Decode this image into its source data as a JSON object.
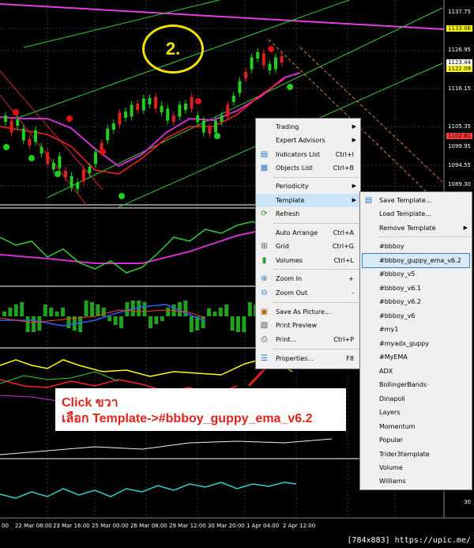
{
  "price_axis": {
    "labels": [
      "1137.75",
      "1126.95",
      "1116.15",
      "1105.35",
      "1099.95",
      "1094.55",
      "1089.30"
    ],
    "tags": [
      {
        "text": "1133.06",
        "color": "#ffff00"
      },
      {
        "text": "1123.44",
        "color": "#ffffff"
      },
      {
        "text": "1122.09",
        "color": "#ffff00"
      },
      {
        "text": "1102.81",
        "color": "#ff3b3b"
      }
    ],
    "indicator_label": "30"
  },
  "time_axis": [
    "00",
    "22 Mar 08:00",
    "23 Mar 16:00",
    "25 Mar 00:00",
    "26 Mar 08:00",
    "29 Mar 12:00",
    "30 Mar 20:00",
    "1 Apr 04:00",
    "2 Apr 12:00"
  ],
  "step_number": "2.",
  "context_menu": {
    "items": [
      {
        "label": "Trading",
        "shortcut": "",
        "icon": "",
        "submenu": true
      },
      {
        "label": "Expert Advisors",
        "shortcut": "",
        "icon": "",
        "submenu": true
      },
      {
        "label": "Indicators List",
        "shortcut": "Ctrl+I",
        "icon": "indicators-list-icon",
        "submenu": false
      },
      {
        "label": "Objects List",
        "shortcut": "Ctrl+B",
        "icon": "objects-list-icon",
        "submenu": false
      },
      {
        "label": "Periodicity",
        "shortcut": "",
        "icon": "",
        "submenu": true
      },
      {
        "label": "Template",
        "shortcut": "",
        "icon": "",
        "submenu": true
      },
      {
        "label": "Refresh",
        "shortcut": "",
        "icon": "refresh-icon",
        "submenu": false
      },
      {
        "label": "Auto Arrange",
        "shortcut": "Ctrl+A",
        "icon": "",
        "submenu": false
      },
      {
        "label": "Grid",
        "shortcut": "Ctrl+G",
        "icon": "grid-icon",
        "submenu": false
      },
      {
        "label": "Volumes",
        "shortcut": "Ctrl+L",
        "icon": "volumes-icon",
        "submenu": false
      },
      {
        "label": "Zoom In",
        "shortcut": "+",
        "icon": "zoom-in-icon",
        "submenu": false
      },
      {
        "label": "Zoom Out",
        "shortcut": "-",
        "icon": "zoom-out-icon",
        "submenu": false
      },
      {
        "label": "Save As Picture...",
        "shortcut": "",
        "icon": "save-picture-icon",
        "submenu": false
      },
      {
        "label": "Print Preview",
        "shortcut": "",
        "icon": "print-preview-icon",
        "submenu": false
      },
      {
        "label": "Print...",
        "shortcut": "Ctrl+P",
        "icon": "print-icon",
        "submenu": false
      },
      {
        "label": "Properties...",
        "shortcut": "F8",
        "icon": "properties-icon",
        "submenu": false
      }
    ]
  },
  "template_submenu": {
    "items": [
      "Save Template...",
      "Load Template...",
      "Remove Template",
      "#bbboy",
      "#bbboy_guppy_ema_v6.2",
      "#bbboy_v5",
      "#bbboy_v6.1",
      "#bbboy_v6.2",
      "#bbboy_v6",
      "#my1",
      "#myadx_guppy",
      "#MyEMA",
      "ADX",
      "BollingerBands",
      "Dinapoli",
      "Layers",
      "Momentum",
      "Popular",
      "Trider3template",
      "Volume",
      "Williams"
    ],
    "selected": "#bbboy_guppy_ema_v6.2"
  },
  "callout": {
    "line1": "Click ขวา",
    "line2": "เลือก Template->#bbboy_guppy_ema_v6.2"
  },
  "watermark": "[784x883] https://upic.me/"
}
